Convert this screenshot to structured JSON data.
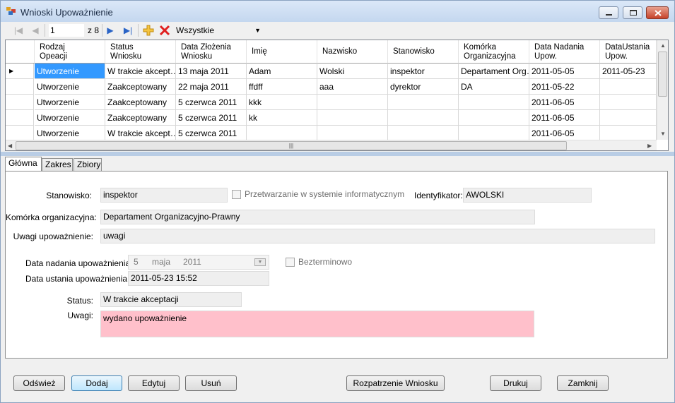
{
  "window": {
    "title": "Wnioski Upoważnienie"
  },
  "toolbar": {
    "position": "1",
    "total": "z 8",
    "filter": "Wszystkie"
  },
  "grid": {
    "columns": [
      "Rodzaj\nOpeacji",
      "Status\nWniosku",
      "Data Złożenia\nWniosku",
      "Imię",
      "Nazwisko",
      "Stanowisko",
      "Komórka\nOrganizacyjna",
      "Data Nadania\nUpow.",
      "DataUstania\nUpow."
    ],
    "rows": [
      [
        "Utworzenie",
        "W trakcie akcept…",
        "13 maja 2011",
        "Adam",
        "Wolski",
        "inspektor",
        "Departament Org…",
        "2011-05-05",
        "2011-05-23"
      ],
      [
        "Utworzenie",
        "Zaakceptowany",
        "22 maja 2011",
        "ffdff",
        "aaa",
        "dyrektor",
        "DA",
        "2011-05-22",
        ""
      ],
      [
        "Utworzenie",
        "Zaakceptowany",
        "5 czerwca 2011",
        "kkk",
        "",
        "",
        "",
        "2011-06-05",
        ""
      ],
      [
        "Utworzenie",
        "Zaakceptowany",
        "5 czerwca 2011",
        "kk",
        "",
        "",
        "",
        "2011-06-05",
        ""
      ],
      [
        "Utworzenie",
        "W trakcie akcept…",
        "5 czerwca 2011",
        "",
        "",
        "",
        "",
        "2011-06-05",
        ""
      ]
    ]
  },
  "tabs": [
    "Główna",
    "Zakres",
    "Zbiory"
  ],
  "form": {
    "stanowisko_label": "Stanowisko:",
    "stanowisko_value": "inspektor",
    "przetwarzanie_label": "Przetwarzanie w systemie informatycznym",
    "identyfikator_label": "Identyfikator:",
    "identyfikator_value": "AWOLSKI",
    "komorka_label": "Komórka organizacyjna:",
    "komorka_value": "Departament Organizacyjno-Prawny",
    "uwagi_upow_label": "Uwagi upoważnienie:",
    "uwagi_upow_value": "uwagi",
    "data_nadania_label": "Data nadania upoważnienia:",
    "data_nadania_day": "5",
    "data_nadania_month": "maja",
    "data_nadania_year": "2011",
    "bezterminowo_label": "Bezterminowo",
    "data_ustania_label": "Data ustania upoważnienia:",
    "data_ustania_value": "2011-05-23 15:52",
    "status_label": "Status:",
    "status_value": "W trakcie akceptacji",
    "uwagi_label": "Uwagi:",
    "uwagi_value": "wydano upoważnienie"
  },
  "buttons": {
    "odswiez": "Odśwież",
    "dodaj": "Dodaj",
    "edytuj": "Edytuj",
    "usun": "Usuń",
    "rozpatrzenie": "Rozpatrzenie Wniosku",
    "drukuj": "Drukuj",
    "zamknij": "Zamknij"
  },
  "icons": {
    "first": "first-record-icon",
    "prev": "previous-record-icon",
    "next": "next-record-icon",
    "last": "last-record-icon",
    "add": "add-icon",
    "delete": "delete-icon"
  },
  "colors": {
    "selection": "#3399ff",
    "uwagi_background": "#ffc0cb",
    "titlebar": "#c4d7ef"
  }
}
